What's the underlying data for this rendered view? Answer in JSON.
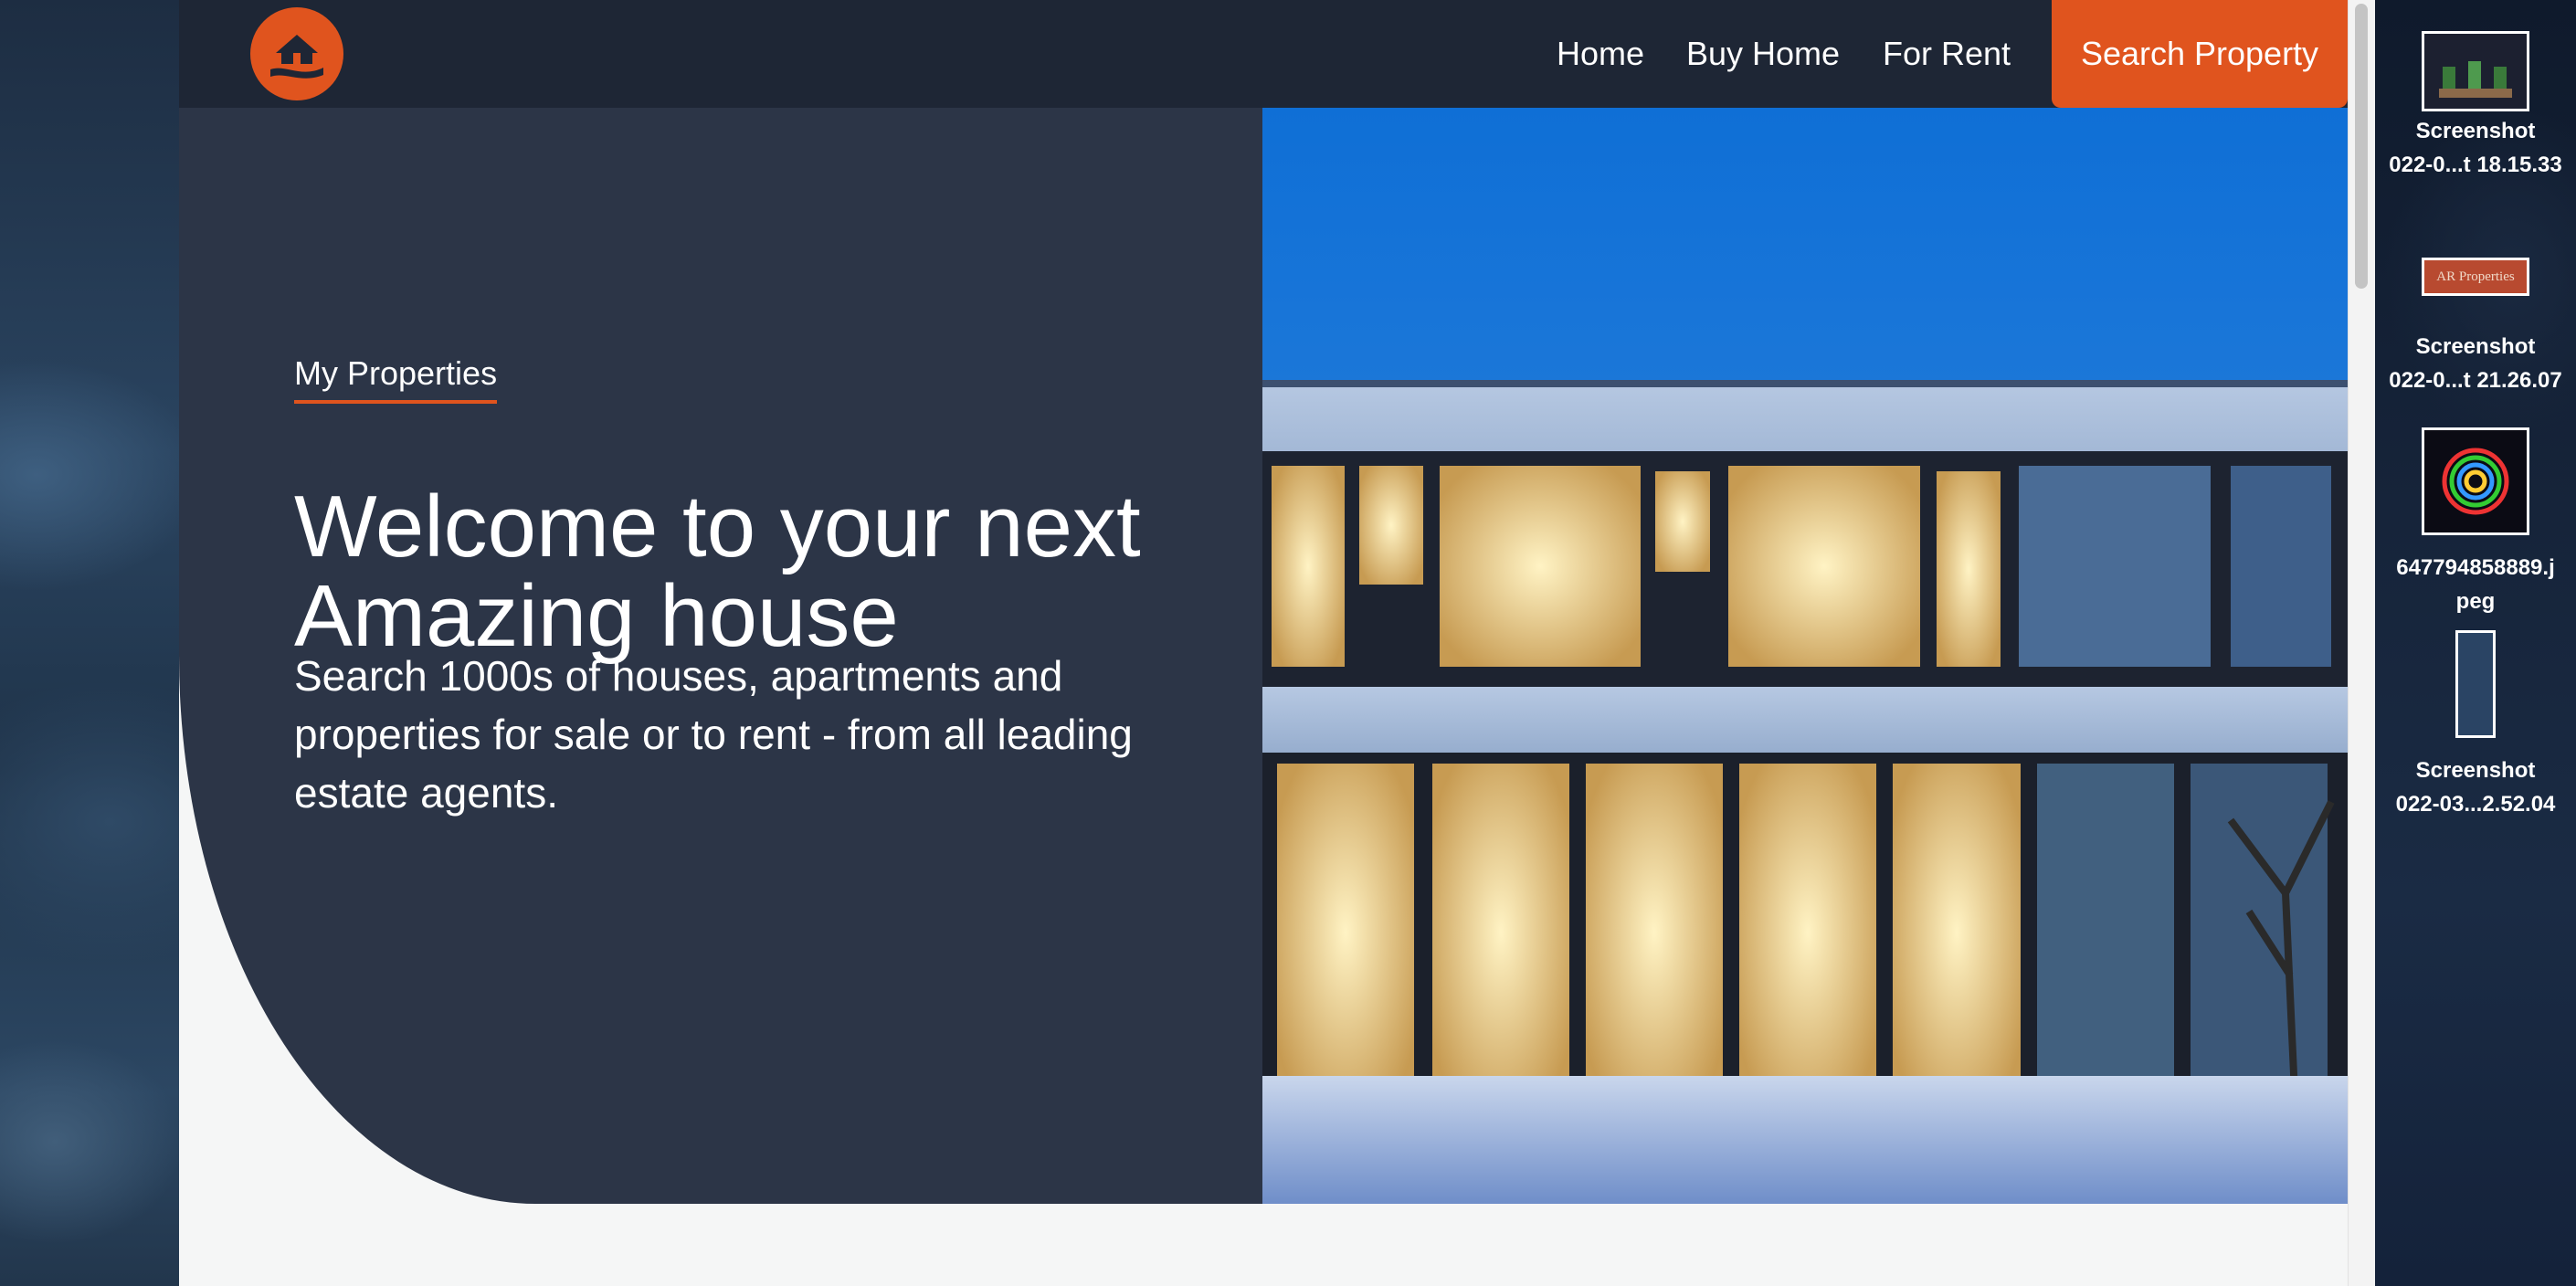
{
  "navbar": {
    "links": [
      "Home",
      "Buy Home",
      "For Rent"
    ],
    "cta": "Search Property"
  },
  "hero": {
    "tag": "My Properties",
    "title_line1": "Welcome to your next",
    "title_line2": "Amazing house",
    "description": "Search 1000s of houses, apartments and properties for sale or to rent - from all leading estate agents."
  },
  "desktop": {
    "files": [
      {
        "name_line1": "Screenshot",
        "name_line2": "022-0...t 18.15.33",
        "icon": "image-thumbnail-icon"
      },
      {
        "name_line1": "Screenshot",
        "name_line2": "022-0...t 21.26.07",
        "icon": "image-thumbnail-icon",
        "thumb_text": "AR Properties"
      },
      {
        "name_line1": "647794858889.j",
        "name_line2": "peg",
        "icon": "image-thumbnail-icon"
      },
      {
        "name_line1": "Screenshot",
        "name_line2": "022-03...2.52.04",
        "icon": "image-thumbnail-icon"
      }
    ]
  },
  "colors": {
    "accent": "#e0541e",
    "navbar": "#1e2635",
    "hero_panel": "#2c3547",
    "page_bg": "#f5f6f6"
  }
}
